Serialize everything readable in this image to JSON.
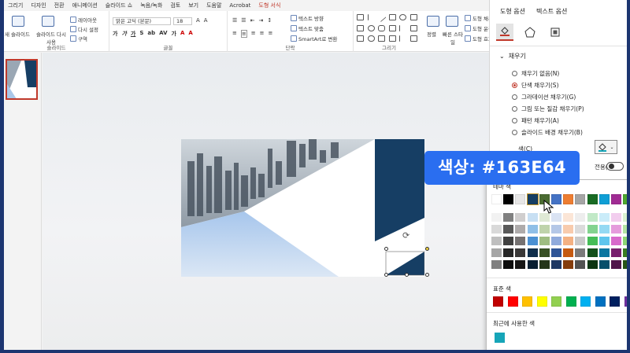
{
  "menu": {
    "tabs": [
      "그리기",
      "디자인",
      "전환",
      "애니메이션",
      "슬라이드 쇼",
      "녹음/녹화",
      "검토",
      "보기",
      "도움말",
      "Acrobat",
      "도형 서식"
    ],
    "active": "도형 서식"
  },
  "ribbon": {
    "slides_group": {
      "label": "슬라이드",
      "new_slide": "새 슬라이드",
      "reuse_slide": "슬라이드 다시 사용",
      "layout": "레이아웃",
      "reset": "다시 설정",
      "section": "구역"
    },
    "font_group": {
      "label": "글꼴",
      "font_name": "맑은 고딕 (본문)",
      "font_size": "18"
    },
    "paragraph_group": {
      "label": "단락",
      "text_direction": "텍스트 방향",
      "align_text": "텍스트 맞춤",
      "smartart": "SmartArt로 변환"
    },
    "drawing_group": {
      "label": "그리기",
      "arrange": "정렬",
      "quick_styles": "빠른 스타일",
      "shape_fill": "도형 채우",
      "shape_outline": "도형 윤곽",
      "shape_effects": "도형 효과"
    }
  },
  "pane": {
    "tabs": [
      "도형 옵션",
      "텍스트 옵션"
    ],
    "icons": [
      "fill-line-icon",
      "effects-icon",
      "size-properties-icon"
    ],
    "fill_section": "채우기",
    "fill_options": [
      {
        "label": "채우기 없음(N)",
        "selected": false
      },
      {
        "label": "단색 채우기(S)",
        "selected": true
      },
      {
        "label": "그라데이션 채우기(G)",
        "selected": false
      },
      {
        "label": "그림 또는 질감 채우기(P)",
        "selected": false
      },
      {
        "label": "패턴 채우기(A)",
        "selected": false
      },
      {
        "label": "슬라이드 배경 채우기(B)",
        "selected": false
      }
    ],
    "color_label": "색(C)",
    "transparency_fragment": "전용(H)"
  },
  "color_dropdown": {
    "theme_label": "테마 색",
    "standard_label": "표준 색",
    "recent_label": "최근에 사용한 색",
    "theme_top": [
      "#ffffff",
      "#000000",
      "#e7e6e6",
      "#163e64",
      "#4a6b32",
      "#4472c4",
      "#ed7d31",
      "#a5a5a5",
      "#196b24",
      "#0f9ed5",
      "#a02b93",
      "#4ea72e"
    ],
    "theme_shades": [
      [
        "#f2f2f2",
        "#d9d9d9",
        "#bfbfbf",
        "#a6a6a6",
        "#808080"
      ],
      [
        "#808080",
        "#595959",
        "#404040",
        "#262626",
        "#0d0d0d"
      ],
      [
        "#d0cece",
        "#aeabab",
        "#757171",
        "#3a3838",
        "#171616"
      ],
      [
        "#c7dff3",
        "#8fbfe7",
        "#4a90d2",
        "#0f2e4b",
        "#0a1f32"
      ],
      [
        "#dfe9d5",
        "#bfd3ab",
        "#9fbd82",
        "#385025",
        "#253519"
      ],
      [
        "#dae3f3",
        "#b4c7e7",
        "#8faadc",
        "#2f5597",
        "#1f3864"
      ],
      [
        "#fbe5d6",
        "#f8cbad",
        "#f4b183",
        "#c55a11",
        "#843c0c"
      ],
      [
        "#ededed",
        "#dbdbdb",
        "#c9c9c9",
        "#7b7b7b",
        "#525252"
      ],
      [
        "#c1e9c7",
        "#83d38f",
        "#45bd57",
        "#13501b",
        "#0d3512"
      ],
      [
        "#caecf9",
        "#95d9f3",
        "#5fc5ed",
        "#0b76a0",
        "#074f6b"
      ],
      [
        "#f2cdee",
        "#e59bdc",
        "#d869cb",
        "#78206e",
        "#50154a"
      ],
      [
        "#d9f1d1",
        "#b3e3a3",
        "#8dd575",
        "#3a7d22",
        "#275317"
      ]
    ],
    "standard": [
      "#c00000",
      "#ff0000",
      "#ffc000",
      "#ffff00",
      "#92d050",
      "#00b050",
      "#00b0f0",
      "#0070c0",
      "#002060",
      "#7030a0"
    ],
    "recent": [
      "#16a5b8"
    ]
  },
  "badge": {
    "text": "색상: #163E64"
  },
  "colors": {
    "accent_red": "#c0392b",
    "slide_navy": "#163e64",
    "badge_blue": "#2a6ef0",
    "frame": "#1c3570"
  }
}
